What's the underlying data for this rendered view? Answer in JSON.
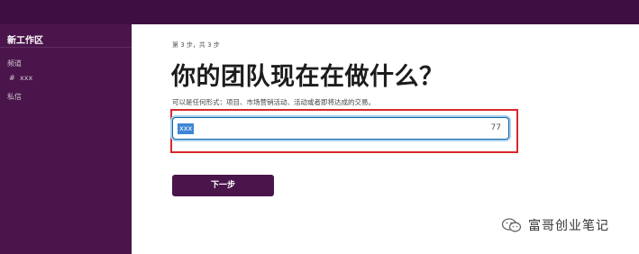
{
  "sidebar": {
    "workspace_name": "新工作区",
    "channels_label": "频道",
    "channel_hash": "#",
    "channel_name": "xxx",
    "direct_messages_label": "私信"
  },
  "main": {
    "step_text": "第 3 步，共 3 步",
    "heading": "你的团队现在在做什么？",
    "description": "可以是任何形式：项目、市场营销活动、活动或者即将达成的交易。",
    "input_value": "xxx",
    "input_counter": "77",
    "next_button_label": "下一步"
  },
  "watermark": {
    "text": "富哥创业笔记",
    "icon": "wechat-icon"
  },
  "colors": {
    "sidebar_bg": "#4a154b",
    "topbar_bg": "#3f0e40",
    "button_bg": "#4a154b",
    "highlight_border": "#d9282b",
    "input_focus": "#1264a3"
  }
}
